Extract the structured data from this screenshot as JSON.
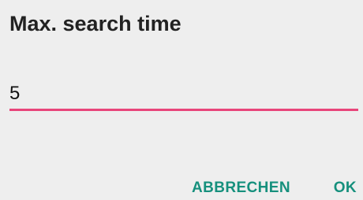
{
  "dialog": {
    "title": "Max. search time",
    "input": {
      "value": "5",
      "underline_color": "#e8457a"
    },
    "buttons": {
      "cancel_label": "ABBRECHEN",
      "ok_label": "OK",
      "color": "#16907d"
    }
  }
}
